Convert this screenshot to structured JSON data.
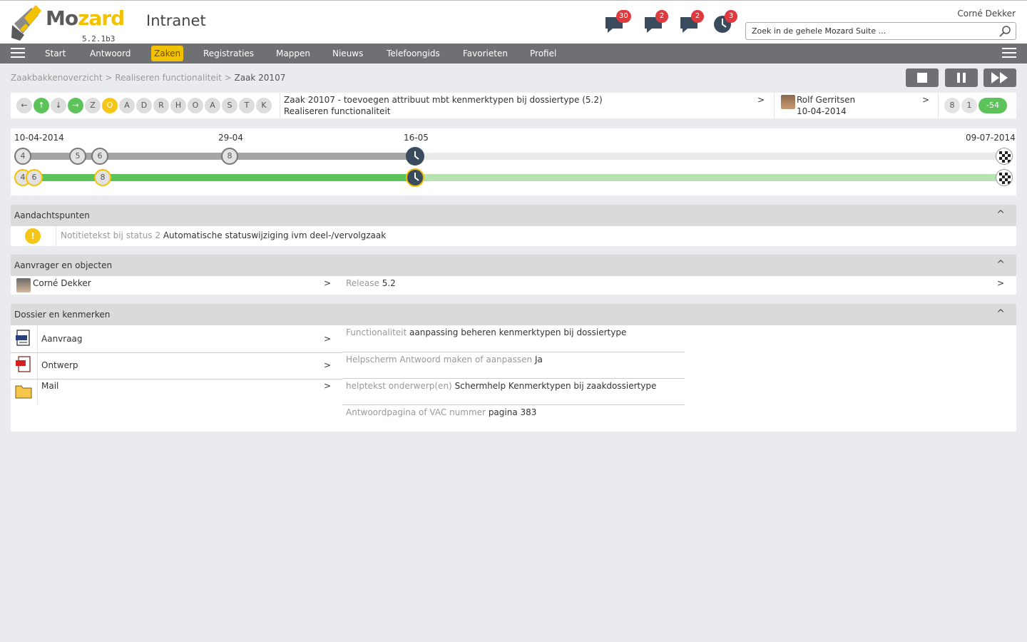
{
  "header": {
    "logo_text_a": "Mo",
    "logo_text_b": "zard",
    "version": "5.2.1b3",
    "app_title": "Intranet",
    "user": "Corné Dekker",
    "search_placeholder": "Zoek in de gehele Mozard Suite ...",
    "notifications": [
      {
        "icon": "chat-bubble-icon",
        "count": "30"
      },
      {
        "icon": "chat-bubble-icon",
        "count": "2"
      },
      {
        "icon": "chat-bubble-icon",
        "count": "2"
      },
      {
        "icon": "clock-icon",
        "count": "3"
      }
    ]
  },
  "nav": {
    "items": [
      "Start",
      "Antwoord",
      "Zaken",
      "Registraties",
      "Mappen",
      "Nieuws",
      "Telefoongids",
      "Favorieten",
      "Profiel"
    ],
    "active": "Zaken"
  },
  "breadcrumb": {
    "part1": "Zaakbakkenoverzicht",
    "sep": " > ",
    "part2": "Realiseren functionaliteit",
    "current": "Zaak 20107"
  },
  "controls": [
    "stop-icon",
    "pause-icon",
    "fast-forward-icon"
  ],
  "status_row": {
    "arrows": [
      "←",
      "↑",
      "↓",
      "→"
    ],
    "letters": [
      "Z",
      "O",
      "A",
      "D",
      "R",
      "H",
      "O",
      "A",
      "S",
      "T",
      "K"
    ],
    "active_letter": "O",
    "zaak_title": "Zaak 20107 - toevoegen attribuut mbt kenmerktypen bij dossiertype (5.2)",
    "zaak_subtitle": "Realiseren functionaliteit",
    "chevron": ">",
    "owner_name": "Rolf Gerritsen",
    "owner_date": "10-04-2014",
    "counts": [
      "8",
      "1",
      "-54"
    ]
  },
  "timeline": {
    "dates": [
      "10-04-2014",
      "29-04",
      "16-05",
      "09-07-2014"
    ],
    "top_nodes": [
      "4",
      "5",
      "6",
      "8"
    ],
    "bottom_nodes": [
      "4",
      "6",
      "8"
    ],
    "progress_fraction": 0.41,
    "colors": {
      "grey_done": "#a5a5a5",
      "grey_todo": "#ebebeb",
      "green_done": "#5cc35a",
      "green_todo": "#b7e3b3",
      "accent": "#f2c200"
    }
  },
  "aandachtspunten": {
    "title": "Aandachtspunten",
    "warn": "!",
    "label": "Notitietekst bij status 2",
    "value": "Automatische statuswijziging ivm deel-/vervolgzaak"
  },
  "aanvrager": {
    "title": "Aanvrager en objecten",
    "person": "Corné Dekker",
    "release_label": "Release",
    "release_value": "5.2"
  },
  "dossier": {
    "title": "Dossier en kenmerken",
    "documents": [
      {
        "name": "Aanvraag",
        "icon": "xml-document-icon"
      },
      {
        "name": "Ontwerp",
        "icon": "pdf-document-icon"
      },
      {
        "name": "Mail",
        "icon": "folder-icon"
      }
    ],
    "kenmerken": [
      {
        "label": "Functionaliteit",
        "value": "aanpassing beheren kenmerktypen bij dossiertype"
      },
      {
        "label": "Helpscherm Antwoord maken of aanpassen",
        "value": "Ja"
      },
      {
        "label": "helptekst onderwerp(en)",
        "value": "Schermhelp Kenmerktypen bij zaakdossiertype"
      },
      {
        "label": "Antwoordpagina of VAC nummer",
        "value": "pagina 383"
      }
    ]
  }
}
